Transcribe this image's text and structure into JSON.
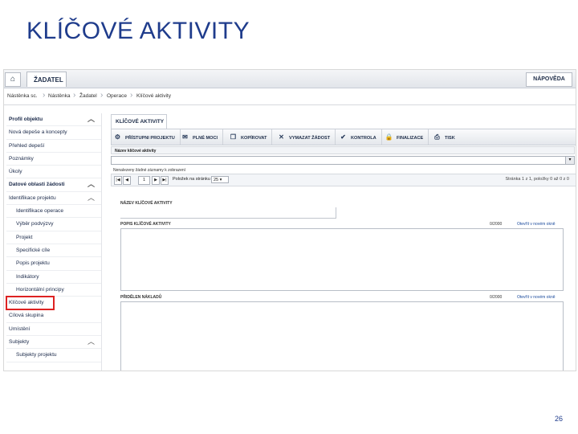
{
  "slide": {
    "title": "KLÍČOVÉ AKTIVITY",
    "page_number": "26"
  },
  "topbar": {
    "home_icon": "home-icon",
    "tab_label": "ŽADATEL",
    "help_label": "NÁPOVĚDA"
  },
  "breadcrumb": [
    "Nástěnka sc.",
    "Nástěnka",
    "Žadatel",
    "Operace",
    "Klíčové aktivity"
  ],
  "sidebar": {
    "items": [
      {
        "label": "Profil objektu",
        "type": "head",
        "chevron": true
      },
      {
        "label": "Nová depeše a koncepty",
        "type": "top"
      },
      {
        "label": "Přehled depeší",
        "type": "top"
      },
      {
        "label": "Poznámky",
        "type": "top"
      },
      {
        "label": "Úkoly",
        "type": "top"
      },
      {
        "label": "Datové oblasti žádosti",
        "type": "head",
        "chevron": true
      },
      {
        "label": "Identifikace projektu",
        "type": "top",
        "chevron": true
      },
      {
        "label": "Identifikace operace",
        "type": "sub"
      },
      {
        "label": "Výběr podvýzvy",
        "type": "sub"
      },
      {
        "label": "Projekt",
        "type": "sub"
      },
      {
        "label": "Specifické cíle",
        "type": "sub"
      },
      {
        "label": "Popis projektu",
        "type": "sub"
      },
      {
        "label": "Indikátory",
        "type": "sub"
      },
      {
        "label": "Horizontální principy",
        "type": "sub"
      },
      {
        "label": "Klíčové aktivity",
        "type": "top",
        "active": true
      },
      {
        "label": "Cílová skupina",
        "type": "top"
      },
      {
        "label": "Umístění",
        "type": "top"
      },
      {
        "label": "Subjekty",
        "type": "top",
        "chevron": true
      },
      {
        "label": "Subjekty projektu",
        "type": "sub"
      }
    ]
  },
  "content": {
    "tab_label": "KLÍČOVÉ AKTIVITY",
    "toolbar": [
      {
        "label": "PŘÍSTUPNI PROJEKTU",
        "icon": "access-icon"
      },
      {
        "label": "PLNÉ MOCI",
        "icon": "mail-icon"
      },
      {
        "label": "KOPÍROVAT",
        "icon": "copy-icon"
      },
      {
        "label": "VYMAZAT ŽÁDOST",
        "icon": "delete-icon"
      },
      {
        "label": "KONTROLA",
        "icon": "check-icon"
      },
      {
        "label": "FINALIZACE",
        "icon": "lock-icon"
      },
      {
        "label": "TISK",
        "icon": "print-icon"
      }
    ],
    "grid_header": "Název klíčové aktivity",
    "grid_note": "Nenalezeny žádné záznamy k zobrazení",
    "pager": {
      "page": "1",
      "page_size_label": "Položek na stránku",
      "page_size": "25",
      "info": "Stránka 1 z 1, položky 0 až 0 z 0"
    },
    "fields": [
      {
        "label": "NÁZEV KLÍČOVÉ AKTIVITY"
      },
      {
        "label": "POPIS KLÍČOVÉ AKTIVITY",
        "count": "0/2000",
        "link": "Otevřít v novém okně"
      },
      {
        "label": "PŘIDĚLEN NÁKLADŮ",
        "count": "0/2000",
        "link": "Otevřít v novém okně"
      }
    ]
  }
}
